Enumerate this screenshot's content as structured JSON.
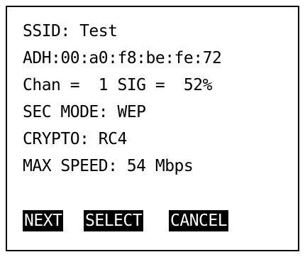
{
  "info": {
    "ssid": "SSID: Test",
    "adh": "ADH:00:a0:f8:be:fe:72",
    "chan_sig": "Chan =  1 SIG =  52%",
    "sec_mode": "SEC MODE: WEP",
    "crypto": "CRYPTO: RC4",
    "max_speed": "MAX SPEED: 54 Mbps"
  },
  "softkeys": {
    "next": "NEXT",
    "select": "SELECT",
    "cancel": "CANCEL"
  }
}
